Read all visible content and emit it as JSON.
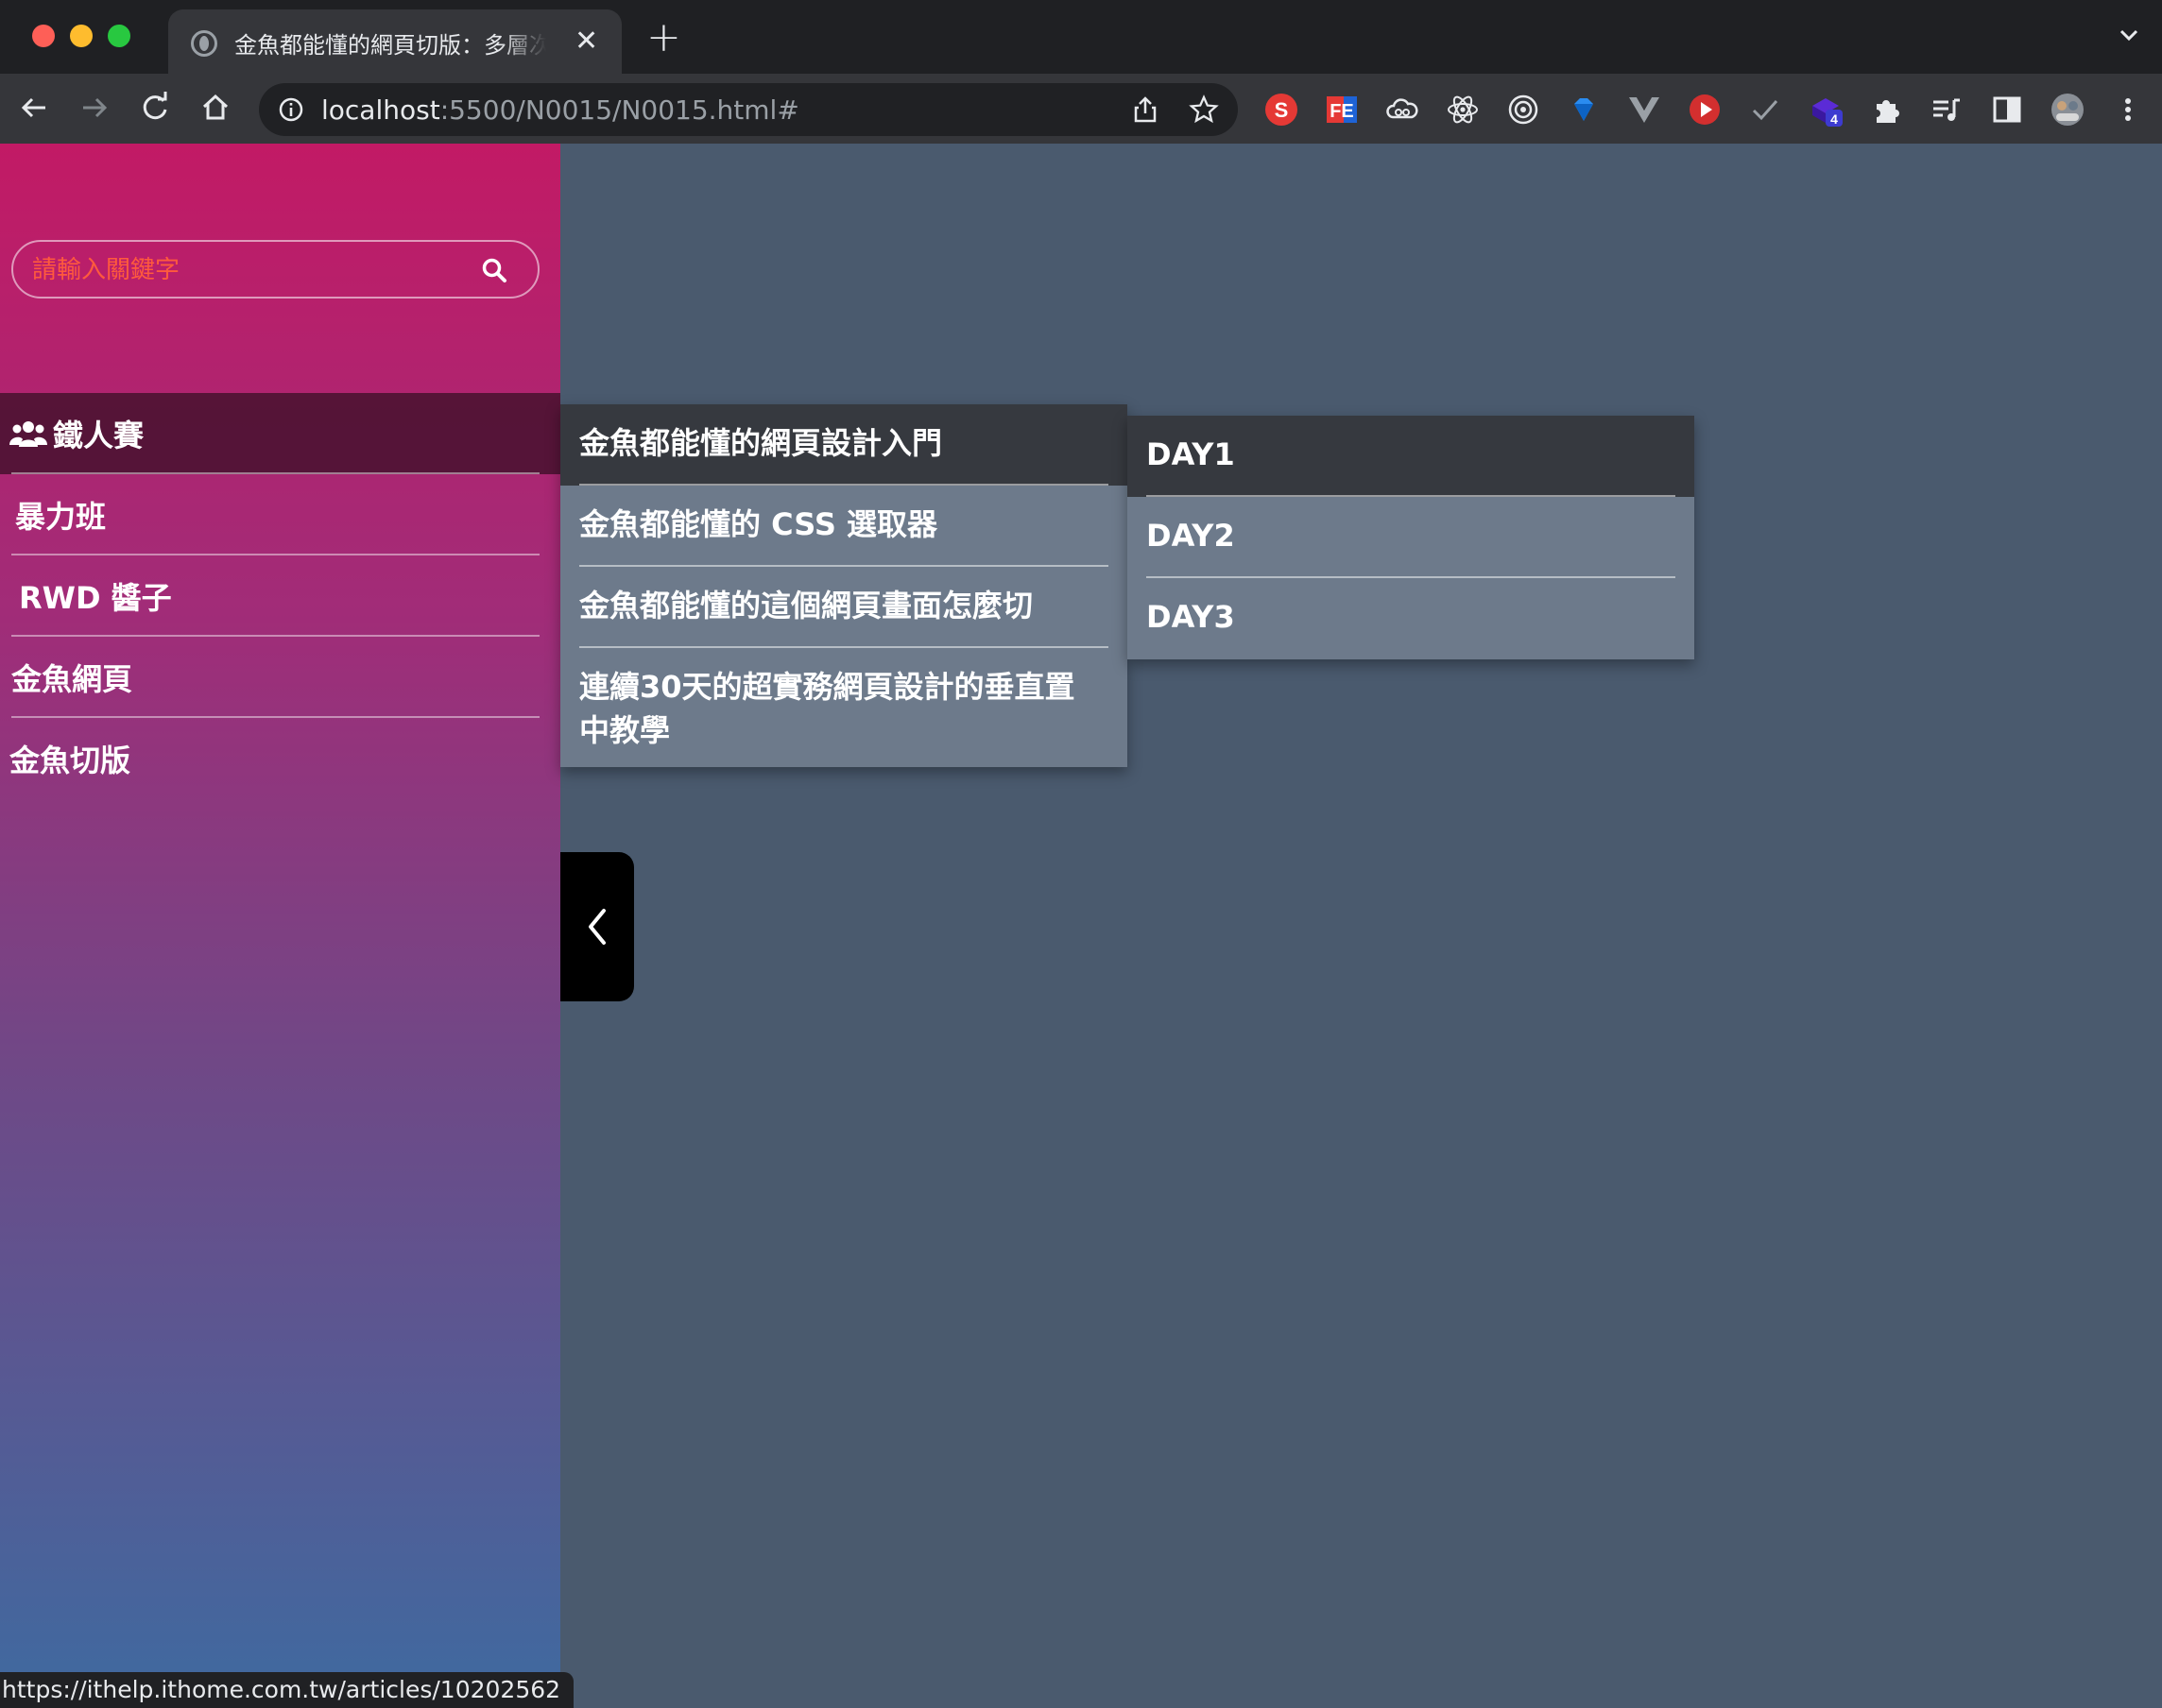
{
  "browser": {
    "tab_title": "金魚都能懂的網頁切版：多層次巢狀選單",
    "url_host": "localhost",
    "url_rest": ":5500/N0015/N0015.html#",
    "status_url": "https://ithelp.ithome.com.tw/articles/10202562",
    "extension_badge": "4"
  },
  "search": {
    "placeholder": "請輸入關鍵字"
  },
  "sidebar": {
    "items": [
      {
        "label": "鐵人賽"
      },
      {
        "label": "暴力班"
      },
      {
        "label": "RWD 醬子"
      },
      {
        "label": "金魚網頁"
      },
      {
        "label": "金魚切版"
      }
    ]
  },
  "submenu1": {
    "items": [
      {
        "label": "金魚都能懂的網頁設計入門"
      },
      {
        "label": "金魚都能懂的 CSS 選取器"
      },
      {
        "label": "金魚都能懂的這個網頁畫面怎麼切"
      },
      {
        "label": "連續30天的超實務網頁設計的垂直置中教學"
      }
    ]
  },
  "submenu2": {
    "items": [
      {
        "label": "DAY1"
      },
      {
        "label": "DAY2"
      },
      {
        "label": "DAY3"
      }
    ]
  },
  "colors": {
    "accent_placeholder": "#ff5a3d",
    "gradient_top": "#c21a65",
    "gradient_bottom": "#3f6aa0",
    "page_bg": "#4a5a6e",
    "submenu_bg": "#6d7a8b",
    "submenu_active": "#36393f"
  }
}
